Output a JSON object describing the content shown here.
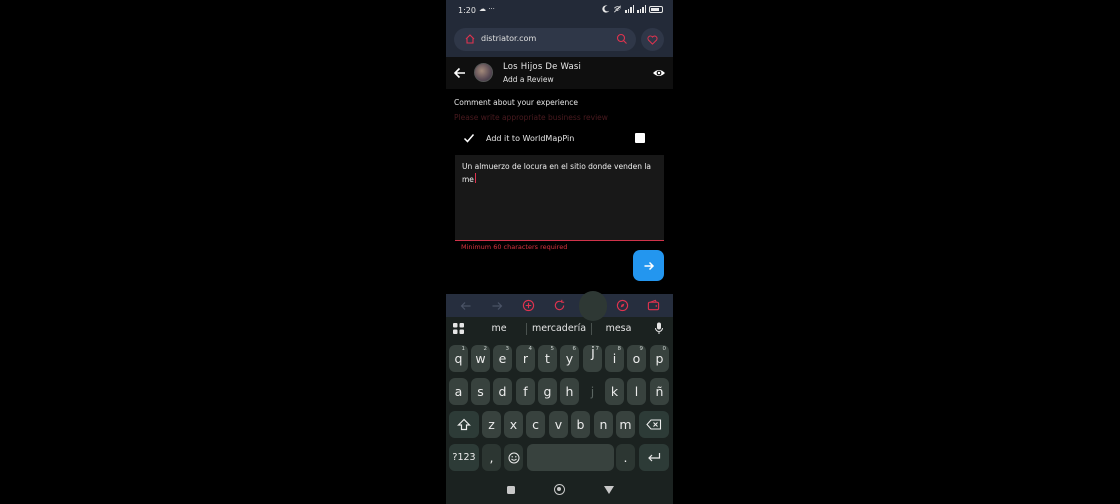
{
  "status_bar": {
    "time": "1:20",
    "left_icons": "☁ ···"
  },
  "browser": {
    "url": "distriator.com"
  },
  "header": {
    "business_name": "Los Hijos De Wasi",
    "subtitle": "Add a Review"
  },
  "form": {
    "comment_title": "Comment about your experience",
    "hint": "Please write appropriate business review",
    "checkbox_label": "Add it to WorldMapPin",
    "review_text": "Un almuerzo de locura en el sitio donde venden la me",
    "error": "Minimum 60 characters required"
  },
  "colors": {
    "accent_red": "#d8323f",
    "fab_blue": "#2396ef",
    "toolbar_red": "#e0334f"
  },
  "keyboard": {
    "suggestions": [
      "me",
      "mercadería",
      "mesa"
    ],
    "row1": [
      {
        "k": "q",
        "s": "1"
      },
      {
        "k": "w",
        "s": "2"
      },
      {
        "k": "e",
        "s": "3"
      },
      {
        "k": "r",
        "s": "4"
      },
      {
        "k": "t",
        "s": "5"
      },
      {
        "k": "y",
        "s": "6"
      },
      {
        "k": "u",
        "s": "7"
      },
      {
        "k": "i",
        "s": "8"
      },
      {
        "k": "o",
        "s": "9"
      },
      {
        "k": "p",
        "s": "0"
      }
    ],
    "popup_key": "j",
    "row2": [
      "a",
      "s",
      "d",
      "f",
      "g",
      "h",
      "j",
      "k",
      "l",
      "ñ"
    ],
    "row3": [
      "z",
      "x",
      "c",
      "v",
      "b",
      "n",
      "m"
    ],
    "symbols_label": "?123",
    "comma": ",",
    "period": "."
  }
}
